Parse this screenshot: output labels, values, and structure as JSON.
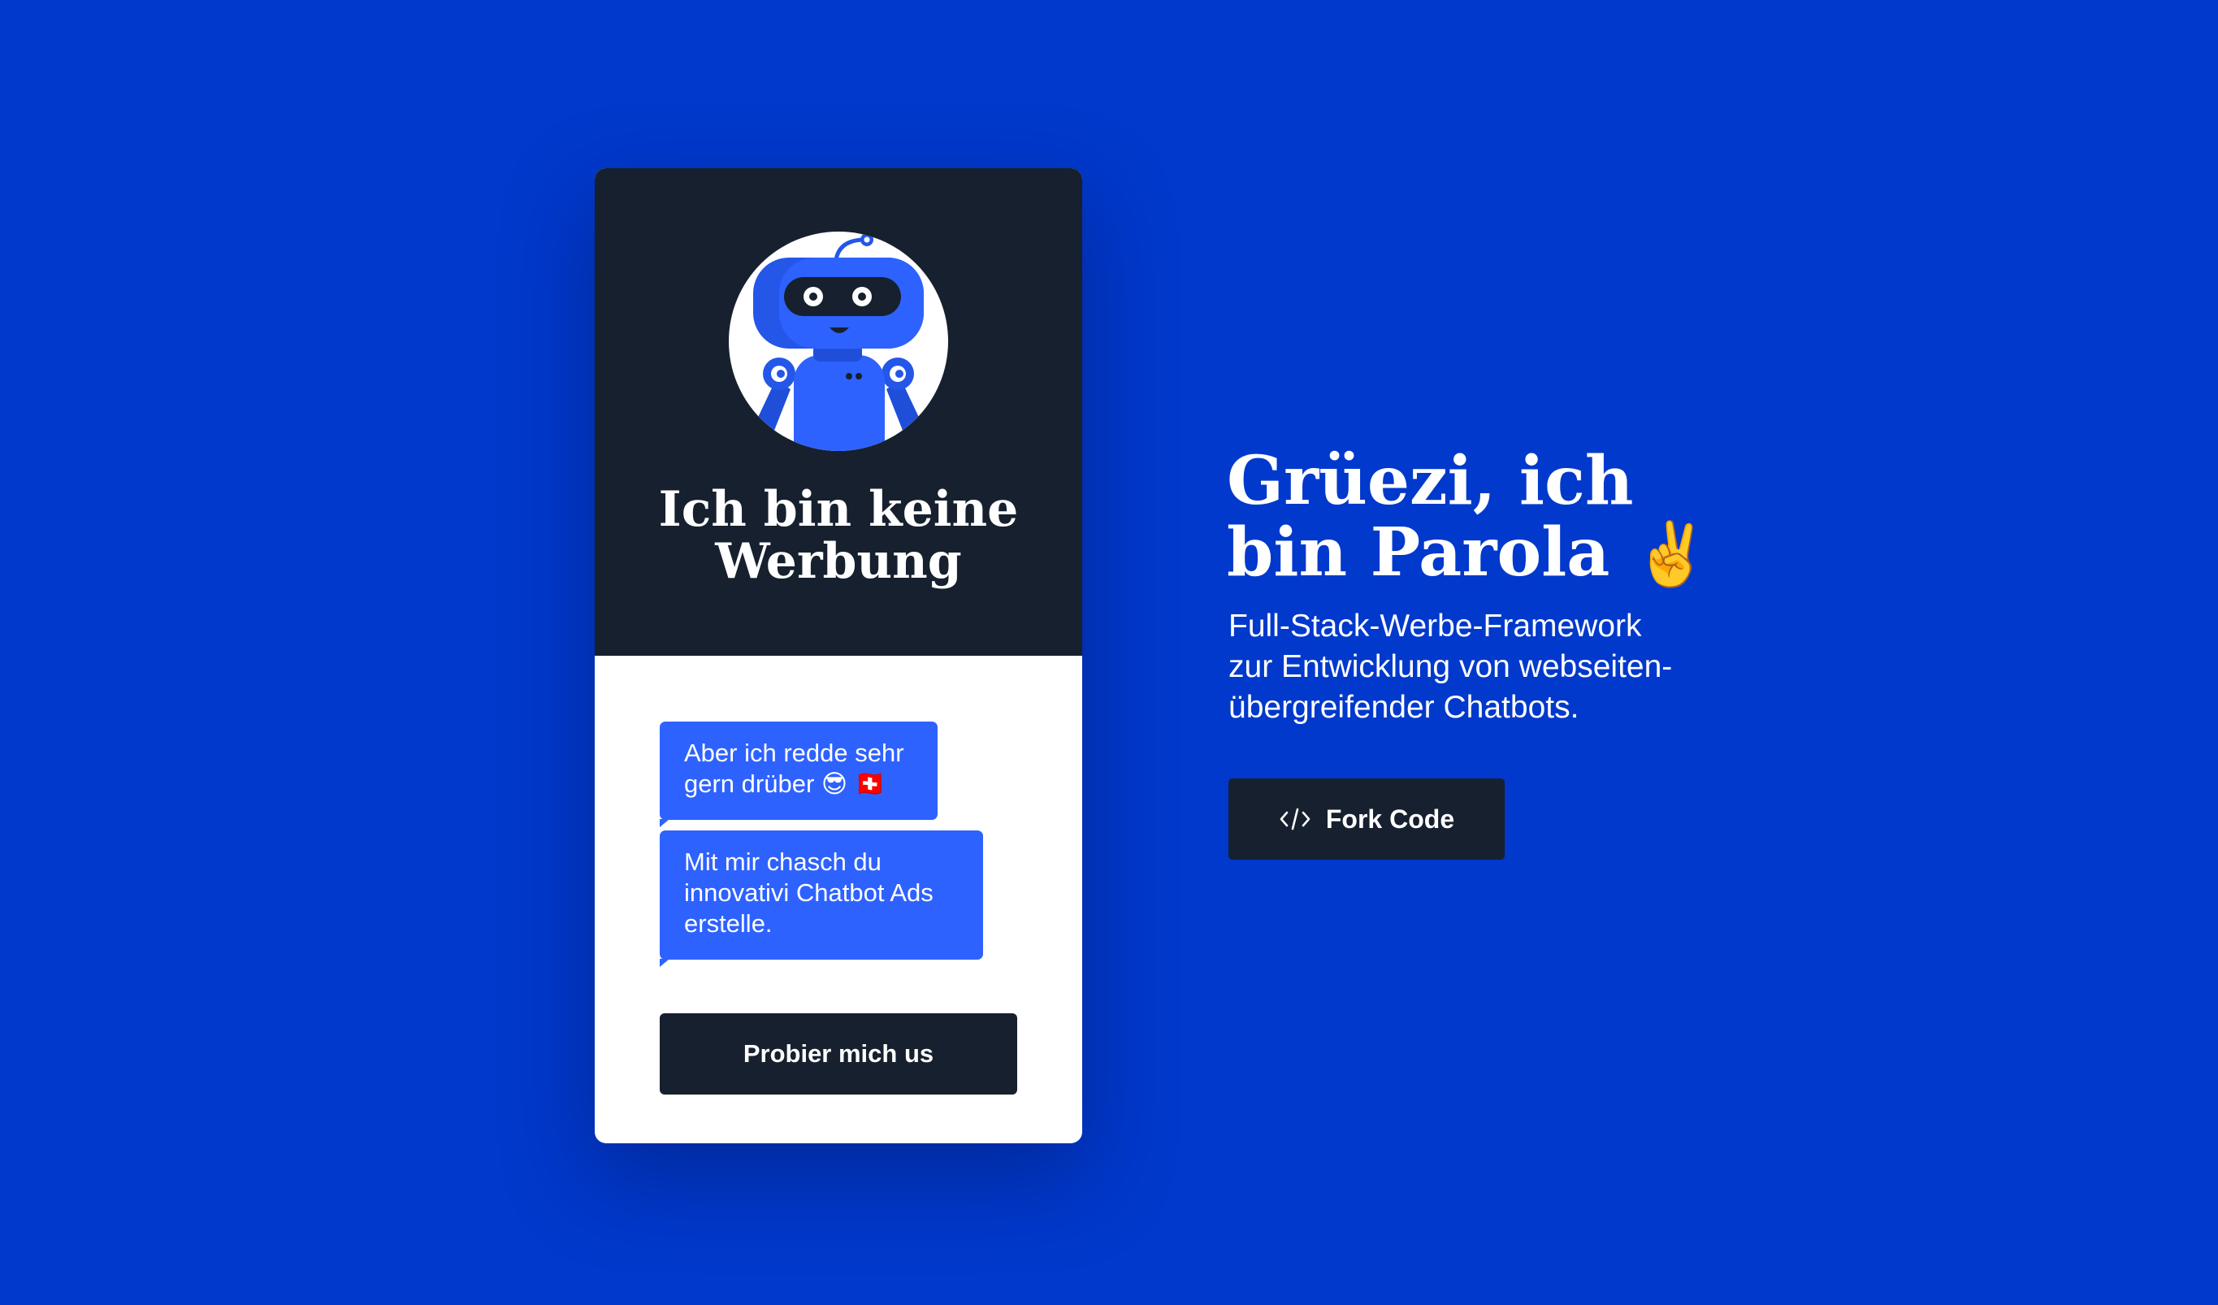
{
  "card": {
    "avatar_icon": "robot-icon",
    "title_line_1": "Ich bin keine",
    "title_line_2": "Werbung",
    "messages": [
      {
        "line_1": "Aber ich redde sehr",
        "line_2": "gern drüber 😎 🇨🇭"
      },
      {
        "line_1": "Mit mir chasch du",
        "line_2": "innovativi Chatbot Ads",
        "line_3": "erstelle."
      }
    ],
    "cta_label": "Probier mich us"
  },
  "hero": {
    "title_line_1": "Grüezi, ich",
    "title_line_2": "bin Parola",
    "title_emoji": "✌️",
    "description_line_1": "Full-Stack-Werbe-Framework",
    "description_line_2": "zur Entwicklung von webseiten-",
    "description_line_3": "übergreifender Chatbots.",
    "fork_label": "Fork Code",
    "fork_icon": "code-icon"
  },
  "colors": {
    "background": "#0039cc",
    "dark": "#17202e",
    "bubble": "#2e62ff",
    "robot_blue": "#2456e8"
  }
}
